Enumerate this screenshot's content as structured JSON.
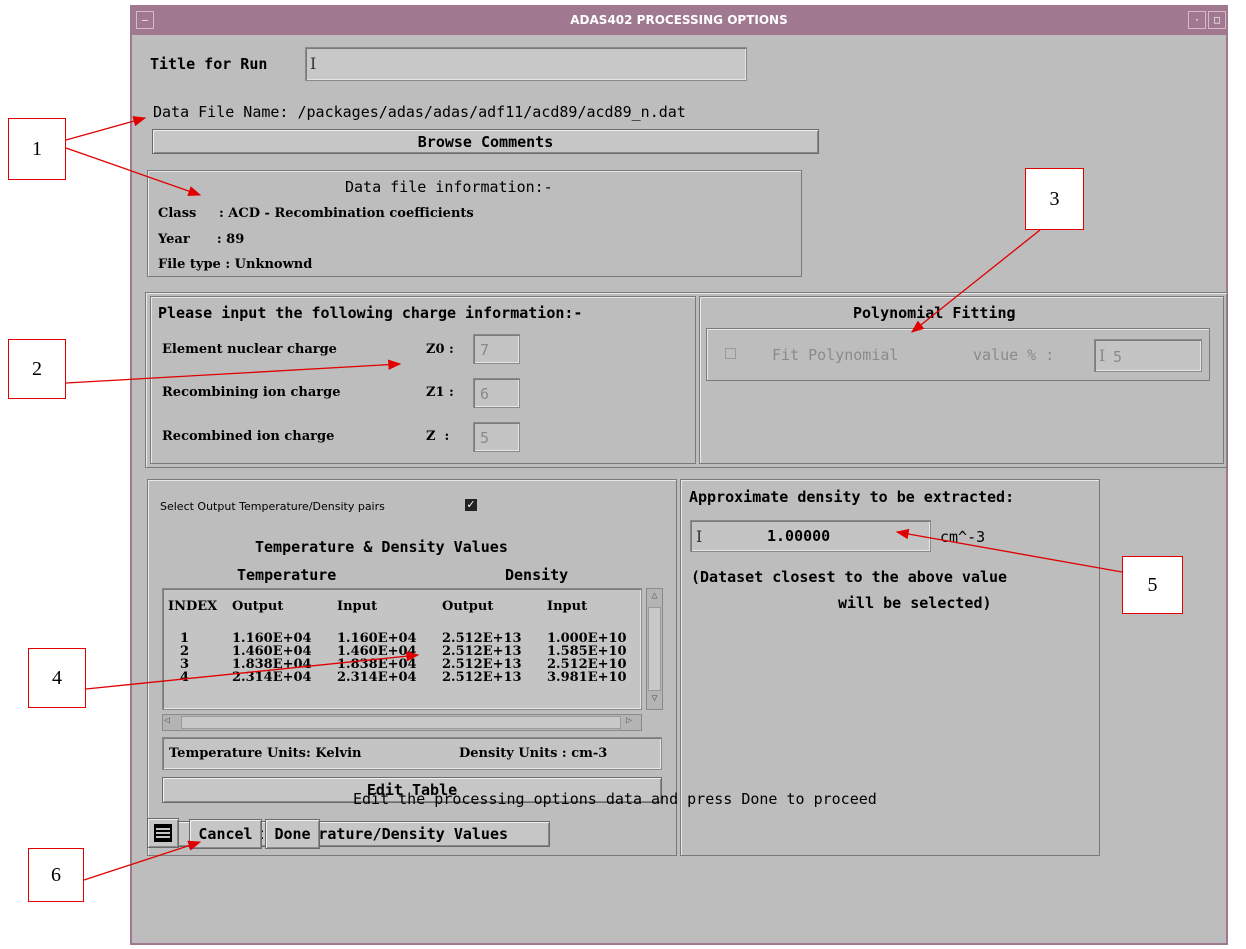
{
  "window": {
    "title": "ADAS402 PROCESSING OPTIONS"
  },
  "title_run": {
    "label": "Title for Run",
    "value": ""
  },
  "data_file": {
    "label": "Data File Name: /packages/adas/adas/adf11/acd89/acd89_n.dat",
    "browse_label": "Browse Comments"
  },
  "file_info": {
    "heading": "Data file information:-",
    "class_line": "Class     : ACD - Recombination coefficients",
    "year_line": "Year      : 89",
    "type_line": "File type : Unknownd"
  },
  "charge": {
    "heading": "Please input the following charge information:-",
    "rows": [
      {
        "label": "Element nuclear charge",
        "sym": "Z0 :",
        "value": "7"
      },
      {
        "label": "Recombining ion charge",
        "sym": "Z1 :",
        "value": "6"
      },
      {
        "label": "Recombined ion charge",
        "sym": "Z  :",
        "value": "5"
      }
    ]
  },
  "poly": {
    "heading": "Polynomial Fitting",
    "checkbox_label": "Fit Polynomial",
    "value_label": "value % :",
    "value": "5"
  },
  "td": {
    "select_label": "Select Output Temperature/Density pairs",
    "heading": "Temperature & Density Values",
    "temp_heading": "Temperature",
    "dens_heading": "Density",
    "columns": [
      "INDEX",
      "Output",
      "Input",
      "Output",
      "Input"
    ],
    "rows": [
      [
        "1",
        "1.160E+04",
        "1.160E+04",
        "2.512E+13",
        "1.000E+10"
      ],
      [
        "2",
        "1.460E+04",
        "1.460E+04",
        "2.512E+13",
        "1.585E+10"
      ],
      [
        "3",
        "1.838E+04",
        "1.838E+04",
        "2.512E+13",
        "2.512E+10"
      ],
      [
        "4",
        "2.314E+04",
        "2.314E+04",
        "2.512E+13",
        "3.981E+10"
      ]
    ],
    "temp_units": "Temperature Units: Kelvin",
    "dens_units": "Density Units : cm-3",
    "edit_label": "Edit Table",
    "default_label": "Default Temperature/Density Values"
  },
  "density": {
    "heading": "Approximate density to be extracted:",
    "value": "1.00000",
    "unit": "cm^-3",
    "note1": "(Dataset closest to the above value",
    "note2": "will be selected)"
  },
  "footer": {
    "message": "Edit the processing options data and press Done to proceed",
    "cancel_label": "Cancel",
    "done_label": "Done"
  },
  "callouts": [
    "1",
    "2",
    "3",
    "4",
    "5",
    "6"
  ],
  "colors": {
    "titlebar": "#a07890",
    "panel": "#bdbdbd",
    "annotation": "#e00000"
  }
}
